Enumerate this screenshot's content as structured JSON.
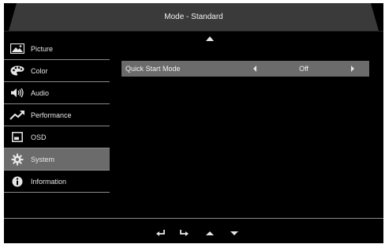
{
  "header": {
    "title": "Mode - Standard"
  },
  "menu": {
    "items": [
      {
        "label": "Picture",
        "icon": "picture-icon",
        "selected": false
      },
      {
        "label": "Color",
        "icon": "palette-icon",
        "selected": false
      },
      {
        "label": "Audio",
        "icon": "speaker-icon",
        "selected": false
      },
      {
        "label": "Performance",
        "icon": "trend-up-icon",
        "selected": false
      },
      {
        "label": "OSD",
        "icon": "osd-window-icon",
        "selected": false
      },
      {
        "label": "System",
        "icon": "gear-icon",
        "selected": true
      },
      {
        "label": "Information",
        "icon": "info-icon",
        "selected": false
      }
    ]
  },
  "option": {
    "label": "Quick Start Mode",
    "value": "Off"
  },
  "footer": {
    "buttons": [
      "back-icon",
      "enter-icon",
      "up-icon",
      "down-icon"
    ]
  },
  "colors": {
    "background": "#000000",
    "header": "#3a3a3a",
    "selected": "#6b6b6b",
    "text": "#e6e6e6"
  }
}
